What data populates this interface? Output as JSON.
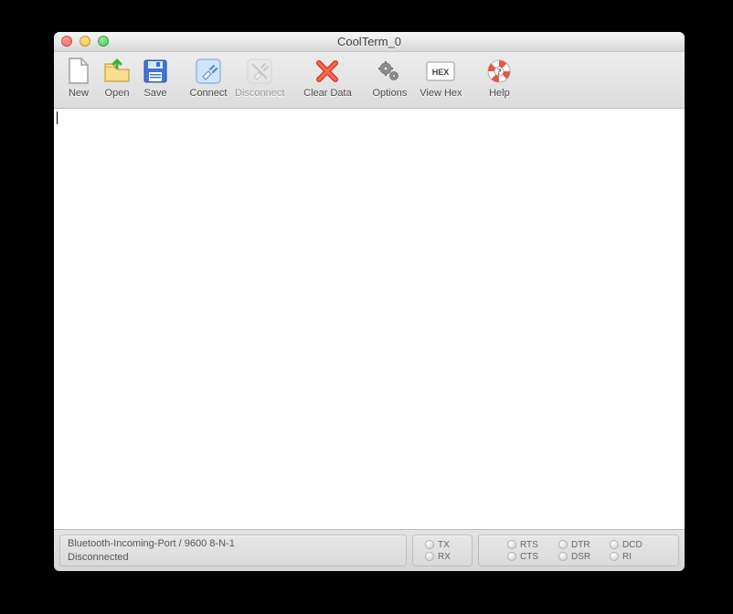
{
  "window": {
    "title": "CoolTerm_0"
  },
  "toolbar": {
    "new": "New",
    "open": "Open",
    "save": "Save",
    "connect": "Connect",
    "disconnect": "Disconnect",
    "clear_data": "Clear Data",
    "options": "Options",
    "view_hex": "View Hex",
    "view_hex_icon_text": "HEX",
    "help": "Help"
  },
  "status": {
    "port_line": "Bluetooth-Incoming-Port / 9600 8-N-1",
    "state": "Disconnected",
    "tx": "TX",
    "rx": "RX",
    "rts": "RTS",
    "cts": "CTS",
    "dtr": "DTR",
    "dsr": "DSR",
    "dcd": "DCD",
    "ri": "RI"
  }
}
